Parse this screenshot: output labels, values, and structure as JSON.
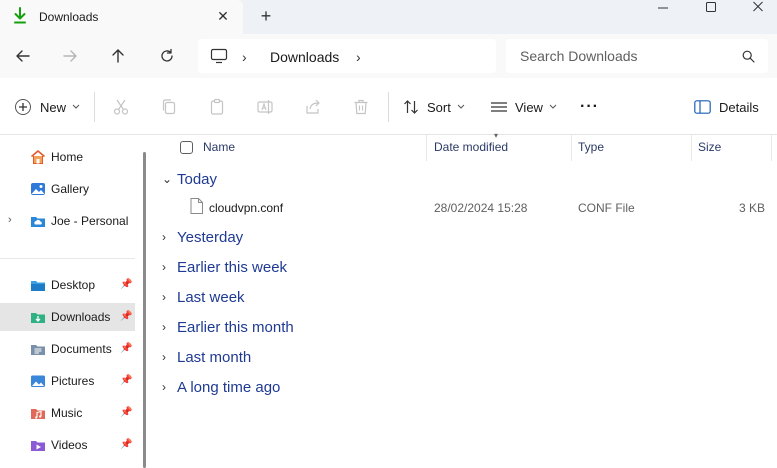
{
  "window": {
    "tab_title": "Downloads",
    "close_tab_glyph": "✕",
    "new_tab_glyph": "+"
  },
  "address": {
    "crumb": "Downloads",
    "separator": "›"
  },
  "search": {
    "placeholder": "Search Downloads"
  },
  "toolbar": {
    "new_label": "New",
    "sort_label": "Sort",
    "view_label": "View",
    "more_glyph": "···",
    "details_label": "Details"
  },
  "sidebar": {
    "items": [
      {
        "label": "Home",
        "icon": "home-icon"
      },
      {
        "label": "Gallery",
        "icon": "gallery-icon"
      },
      {
        "label": "Joe - Personal",
        "icon": "onedrive-folder-icon"
      },
      {
        "label": "Desktop",
        "icon": "desktop-folder-icon"
      },
      {
        "label": "Downloads",
        "icon": "downloads-folder-icon"
      },
      {
        "label": "Documents",
        "icon": "documents-folder-icon"
      },
      {
        "label": "Pictures",
        "icon": "pictures-folder-icon"
      },
      {
        "label": "Music",
        "icon": "music-folder-icon"
      },
      {
        "label": "Videos",
        "icon": "videos-folder-icon"
      }
    ],
    "selected": "Downloads"
  },
  "columns": {
    "name": "Name",
    "date": "Date modified",
    "type": "Type",
    "size": "Size"
  },
  "groups": [
    "Today",
    "Yesterday",
    "Earlier this week",
    "Last week",
    "Earlier this month",
    "Last month",
    "A long time ago"
  ],
  "files": [
    {
      "name": "cloudvpn.conf",
      "date": "28/02/2024 15:28",
      "type": "CONF File",
      "size": "3 KB"
    }
  ],
  "colors": {
    "accent": "#0067c0",
    "group_text": "#1f3a93",
    "selected_bg": "#e5e5e5",
    "download_green": "#13a10e"
  }
}
